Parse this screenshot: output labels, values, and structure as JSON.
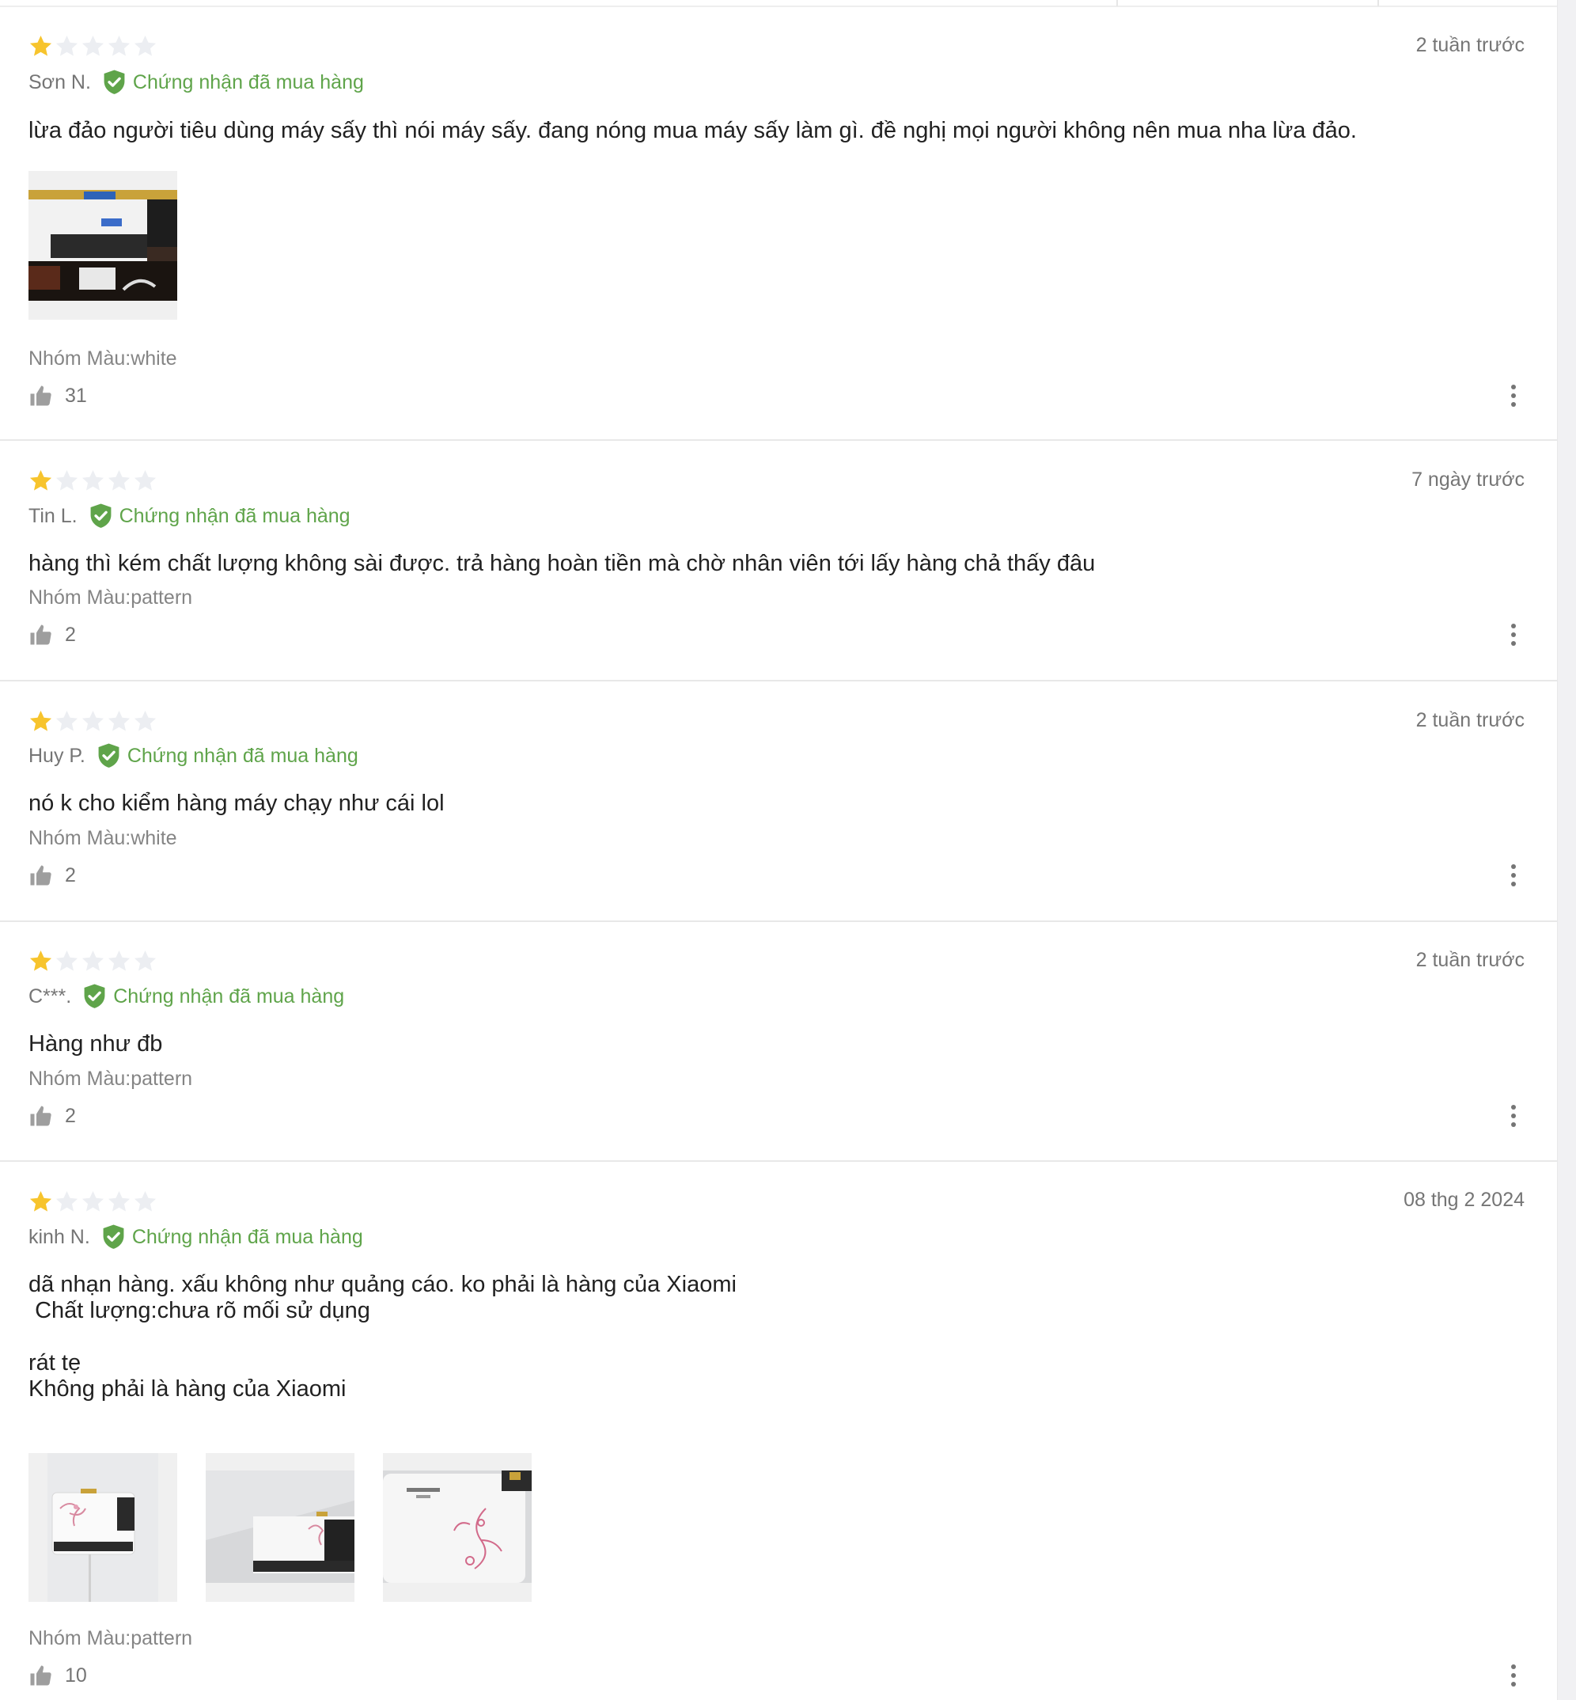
{
  "colors": {
    "star_filled": "#f7c42d",
    "star_empty": "#eceef2",
    "verified_green": "#5fa44a"
  },
  "reviews": [
    {
      "rating": 1,
      "rating_max": 5,
      "date": "2 tuần trước",
      "author": "Sơn N.",
      "verified_label": "Chứng nhận đã mua hàng",
      "content": "lừa đảo người tiêu dùng máy sấy thì nói máy sấy. đang nóng mua máy sấy làm gì. đề nghị mọi người không nên mua nha lừa đảo.",
      "images": [
        "review-photo-heater-box"
      ],
      "sku": "Nhóm Màu:white",
      "likes": "31"
    },
    {
      "rating": 1,
      "rating_max": 5,
      "date": "7 ngày trước",
      "author": "Tin L.",
      "verified_label": "Chứng nhận đã mua hàng",
      "content": "hàng thì kém chất lượng không sài được. trả hàng hoàn tiền mà chờ nhân viên tới lấy hàng chả thấy đâu",
      "images": [],
      "sku": "Nhóm Màu:pattern",
      "likes": "2"
    },
    {
      "rating": 1,
      "rating_max": 5,
      "date": "2 tuần trước",
      "author": "Huy P.",
      "verified_label": "Chứng nhận đã mua hàng",
      "content": "nó k cho kiểm hàng máy chạy như cái lol",
      "images": [],
      "sku": "Nhóm Màu:white",
      "likes": "2"
    },
    {
      "rating": 1,
      "rating_max": 5,
      "date": "2 tuần trước",
      "author": "C***.",
      "verified_label": "Chứng nhận đã mua hàng",
      "content": "Hàng như đb",
      "images": [],
      "sku": "Nhóm Màu:pattern",
      "likes": "2"
    },
    {
      "rating": 1,
      "rating_max": 5,
      "date": "08 thg 2 2024",
      "author": "kinh N.",
      "verified_label": "Chứng nhận đã mua hàng",
      "content": "dã nhạn hàng. xấu không như quảng cáo. ko phải là hàng của Xiaomi\n Chất lượng:chưa rõ mối sử dụng\n\nrát tẹ\nKhông phải là hàng của Xiaomi",
      "images": [
        "review-photo-heater-front",
        "review-photo-heater-wall",
        "review-photo-heater-closeup"
      ],
      "sku": "Nhóm Màu:pattern",
      "likes": "10"
    }
  ]
}
